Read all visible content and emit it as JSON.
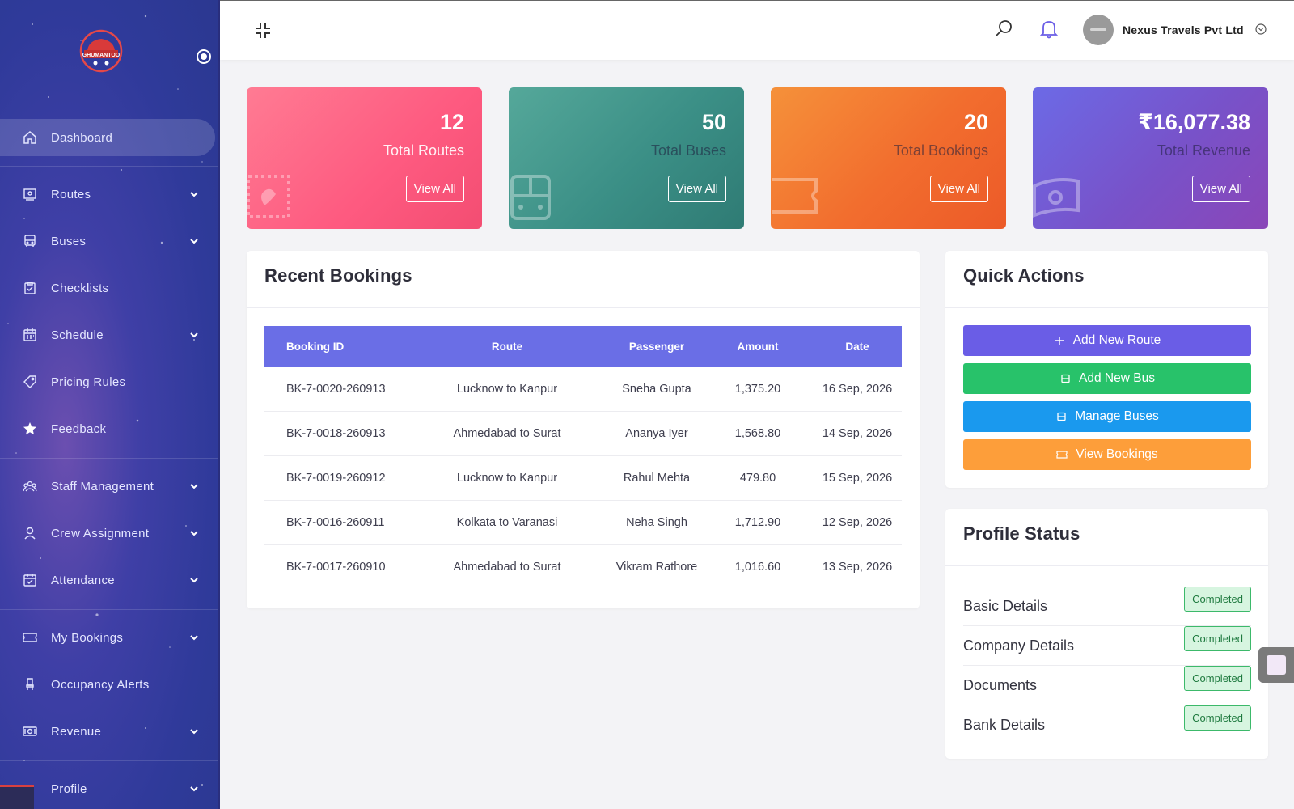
{
  "brand": {
    "logo_text": "GHUMANTOO"
  },
  "sidebar": {
    "items": [
      {
        "label": "Dashboard",
        "icon": "home-icon",
        "active": true
      },
      {
        "label": "Routes",
        "icon": "route-icon",
        "has_submenu": true
      },
      {
        "label": "Buses",
        "icon": "bus-icon",
        "has_submenu": true
      },
      {
        "label": "Checklists",
        "icon": "checklist-icon"
      },
      {
        "label": "Schedule",
        "icon": "calendar-icon",
        "has_submenu": true
      },
      {
        "label": "Pricing Rules",
        "icon": "tag-icon"
      },
      {
        "label": "Feedback",
        "icon": "star-icon"
      },
      {
        "label": "Staff Management",
        "icon": "staff-icon",
        "has_submenu": true
      },
      {
        "label": "Crew Assignment",
        "icon": "user-icon",
        "has_submenu": true
      },
      {
        "label": "Attendance",
        "icon": "attendance-icon",
        "has_submenu": true
      },
      {
        "label": "My Bookings",
        "icon": "ticket-icon",
        "has_submenu": true
      },
      {
        "label": "Occupancy Alerts",
        "icon": "seat-icon"
      },
      {
        "label": "Revenue",
        "icon": "money-icon",
        "has_submenu": true
      },
      {
        "label": "Profile",
        "icon": "profile-icon",
        "has_submenu": true
      }
    ]
  },
  "header": {
    "company_name": "Nexus Travels Pvt Ltd"
  },
  "stats": [
    {
      "value": "12",
      "label": "Total Routes",
      "action": "View All"
    },
    {
      "value": "50",
      "label": "Total Buses",
      "action": "View All"
    },
    {
      "value": "20",
      "label": "Total Bookings",
      "action": "View All"
    },
    {
      "value": "₹16,077.38",
      "label": "Total Revenue",
      "action": "View All"
    }
  ],
  "recent_bookings": {
    "title": "Recent Bookings",
    "columns": [
      "Booking ID",
      "Route",
      "Passenger",
      "Amount",
      "Date"
    ],
    "rows": [
      [
        "BK-7-0020-260913",
        "Lucknow to Kanpur",
        "Sneha Gupta",
        "1,375.20",
        "16 Sep, 2026"
      ],
      [
        "BK-7-0018-260913",
        "Ahmedabad to Surat",
        "Ananya Iyer",
        "1,568.80",
        "14 Sep, 2026"
      ],
      [
        "BK-7-0019-260912",
        "Lucknow to Kanpur",
        "Rahul Mehta",
        "479.80",
        "15 Sep, 2026"
      ],
      [
        "BK-7-0016-260911",
        "Kolkata to Varanasi",
        "Neha Singh",
        "1,712.90",
        "12 Sep, 2026"
      ],
      [
        "BK-7-0017-260910",
        "Ahmedabad to Surat",
        "Vikram Rathore",
        "1,016.60",
        "13 Sep, 2026"
      ]
    ]
  },
  "quick_actions": {
    "title": "Quick Actions",
    "buttons": [
      {
        "label": "Add New Route",
        "icon": "plus-icon",
        "color": "#6a5de6"
      },
      {
        "label": "Add New Bus",
        "icon": "bus-icon",
        "color": "#28c26a"
      },
      {
        "label": "Manage Buses",
        "icon": "bus-icon",
        "color": "#1a99ee"
      },
      {
        "label": "View Bookings",
        "icon": "ticket-icon",
        "color": "#fd9e3a"
      }
    ]
  },
  "profile_status": {
    "title": "Profile Status",
    "items": [
      {
        "label": "Basic Details",
        "status": "Completed"
      },
      {
        "label": "Company Details",
        "status": "Completed"
      },
      {
        "label": "Documents",
        "status": "Completed"
      },
      {
        "label": "Bank Details",
        "status": "Completed"
      }
    ]
  },
  "colors": {
    "sidebar_bg": "#2f3a9a",
    "table_header": "#6a6ee6",
    "success_badge": "#d7f5e0"
  }
}
